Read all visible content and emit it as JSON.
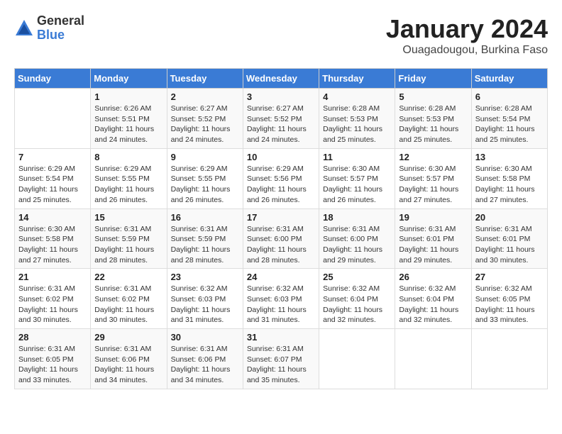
{
  "logo": {
    "general": "General",
    "blue": "Blue"
  },
  "title": "January 2024",
  "location": "Ouagadougou, Burkina Faso",
  "days_of_week": [
    "Sunday",
    "Monday",
    "Tuesday",
    "Wednesday",
    "Thursday",
    "Friday",
    "Saturday"
  ],
  "weeks": [
    [
      {
        "day": "",
        "info": ""
      },
      {
        "day": "1",
        "info": "Sunrise: 6:26 AM\nSunset: 5:51 PM\nDaylight: 11 hours\nand 24 minutes."
      },
      {
        "day": "2",
        "info": "Sunrise: 6:27 AM\nSunset: 5:52 PM\nDaylight: 11 hours\nand 24 minutes."
      },
      {
        "day": "3",
        "info": "Sunrise: 6:27 AM\nSunset: 5:52 PM\nDaylight: 11 hours\nand 24 minutes."
      },
      {
        "day": "4",
        "info": "Sunrise: 6:28 AM\nSunset: 5:53 PM\nDaylight: 11 hours\nand 25 minutes."
      },
      {
        "day": "5",
        "info": "Sunrise: 6:28 AM\nSunset: 5:53 PM\nDaylight: 11 hours\nand 25 minutes."
      },
      {
        "day": "6",
        "info": "Sunrise: 6:28 AM\nSunset: 5:54 PM\nDaylight: 11 hours\nand 25 minutes."
      }
    ],
    [
      {
        "day": "7",
        "info": "Sunrise: 6:29 AM\nSunset: 5:54 PM\nDaylight: 11 hours\nand 25 minutes."
      },
      {
        "day": "8",
        "info": "Sunrise: 6:29 AM\nSunset: 5:55 PM\nDaylight: 11 hours\nand 26 minutes."
      },
      {
        "day": "9",
        "info": "Sunrise: 6:29 AM\nSunset: 5:55 PM\nDaylight: 11 hours\nand 26 minutes."
      },
      {
        "day": "10",
        "info": "Sunrise: 6:29 AM\nSunset: 5:56 PM\nDaylight: 11 hours\nand 26 minutes."
      },
      {
        "day": "11",
        "info": "Sunrise: 6:30 AM\nSunset: 5:57 PM\nDaylight: 11 hours\nand 26 minutes."
      },
      {
        "day": "12",
        "info": "Sunrise: 6:30 AM\nSunset: 5:57 PM\nDaylight: 11 hours\nand 27 minutes."
      },
      {
        "day": "13",
        "info": "Sunrise: 6:30 AM\nSunset: 5:58 PM\nDaylight: 11 hours\nand 27 minutes."
      }
    ],
    [
      {
        "day": "14",
        "info": "Sunrise: 6:30 AM\nSunset: 5:58 PM\nDaylight: 11 hours\nand 27 minutes."
      },
      {
        "day": "15",
        "info": "Sunrise: 6:31 AM\nSunset: 5:59 PM\nDaylight: 11 hours\nand 28 minutes."
      },
      {
        "day": "16",
        "info": "Sunrise: 6:31 AM\nSunset: 5:59 PM\nDaylight: 11 hours\nand 28 minutes."
      },
      {
        "day": "17",
        "info": "Sunrise: 6:31 AM\nSunset: 6:00 PM\nDaylight: 11 hours\nand 28 minutes."
      },
      {
        "day": "18",
        "info": "Sunrise: 6:31 AM\nSunset: 6:00 PM\nDaylight: 11 hours\nand 29 minutes."
      },
      {
        "day": "19",
        "info": "Sunrise: 6:31 AM\nSunset: 6:01 PM\nDaylight: 11 hours\nand 29 minutes."
      },
      {
        "day": "20",
        "info": "Sunrise: 6:31 AM\nSunset: 6:01 PM\nDaylight: 11 hours\nand 30 minutes."
      }
    ],
    [
      {
        "day": "21",
        "info": "Sunrise: 6:31 AM\nSunset: 6:02 PM\nDaylight: 11 hours\nand 30 minutes."
      },
      {
        "day": "22",
        "info": "Sunrise: 6:31 AM\nSunset: 6:02 PM\nDaylight: 11 hours\nand 30 minutes."
      },
      {
        "day": "23",
        "info": "Sunrise: 6:32 AM\nSunset: 6:03 PM\nDaylight: 11 hours\nand 31 minutes."
      },
      {
        "day": "24",
        "info": "Sunrise: 6:32 AM\nSunset: 6:03 PM\nDaylight: 11 hours\nand 31 minutes."
      },
      {
        "day": "25",
        "info": "Sunrise: 6:32 AM\nSunset: 6:04 PM\nDaylight: 11 hours\nand 32 minutes."
      },
      {
        "day": "26",
        "info": "Sunrise: 6:32 AM\nSunset: 6:04 PM\nDaylight: 11 hours\nand 32 minutes."
      },
      {
        "day": "27",
        "info": "Sunrise: 6:32 AM\nSunset: 6:05 PM\nDaylight: 11 hours\nand 33 minutes."
      }
    ],
    [
      {
        "day": "28",
        "info": "Sunrise: 6:31 AM\nSunset: 6:05 PM\nDaylight: 11 hours\nand 33 minutes."
      },
      {
        "day": "29",
        "info": "Sunrise: 6:31 AM\nSunset: 6:06 PM\nDaylight: 11 hours\nand 34 minutes."
      },
      {
        "day": "30",
        "info": "Sunrise: 6:31 AM\nSunset: 6:06 PM\nDaylight: 11 hours\nand 34 minutes."
      },
      {
        "day": "31",
        "info": "Sunrise: 6:31 AM\nSunset: 6:07 PM\nDaylight: 11 hours\nand 35 minutes."
      },
      {
        "day": "",
        "info": ""
      },
      {
        "day": "",
        "info": ""
      },
      {
        "day": "",
        "info": ""
      }
    ]
  ]
}
